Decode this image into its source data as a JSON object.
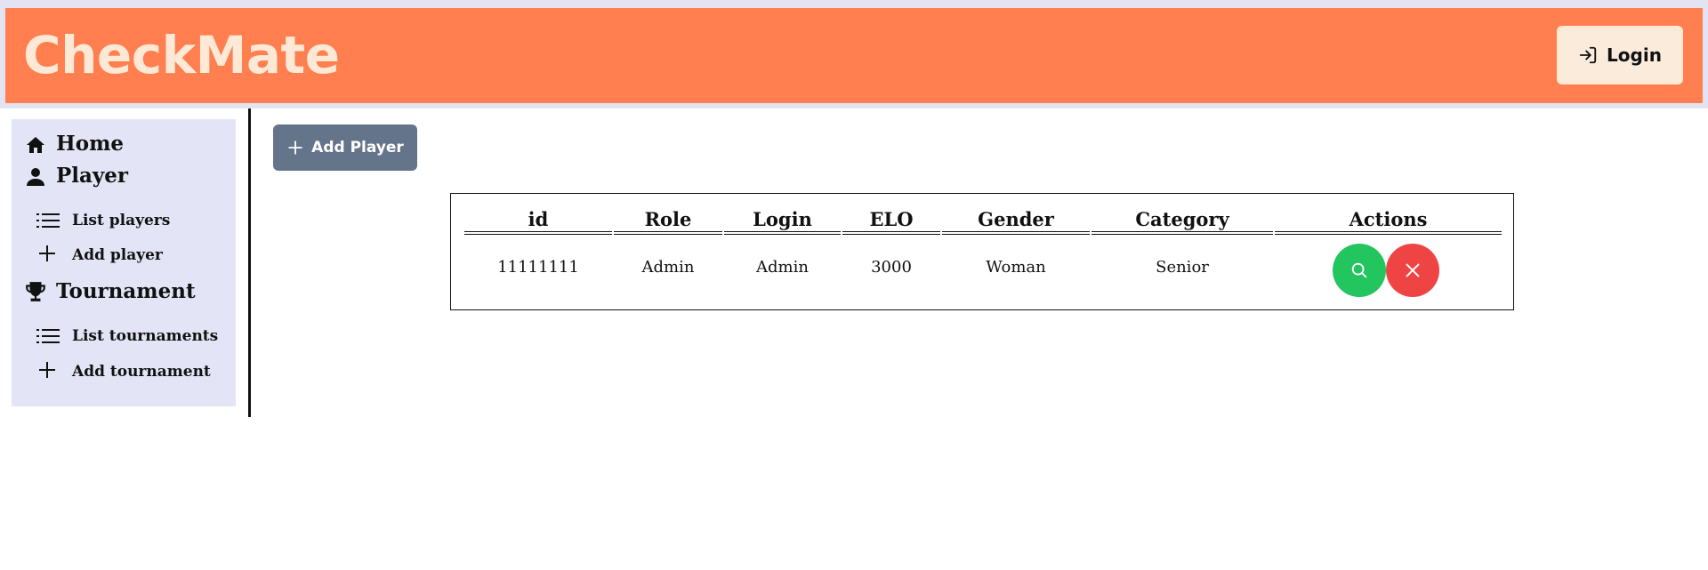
{
  "header": {
    "brand": "CheckMate",
    "login_label": "Login",
    "colors": {
      "bar": "#ff7f50",
      "brand_text": "#fde9d5",
      "login_bg": "#faebdb"
    }
  },
  "sidebar": {
    "home": "Home",
    "player": "Player",
    "list_players": "List players",
    "add_player": "Add player",
    "tournament": "Tournament",
    "list_tournaments": "List tournaments",
    "add_tournament": "Add tournament"
  },
  "main": {
    "add_player_button": "Add Player",
    "table": {
      "headers": [
        "id",
        "Role",
        "Login",
        "ELO",
        "Gender",
        "Category",
        "Actions"
      ],
      "rows": [
        [
          "11111111",
          "Admin",
          "Admin",
          "3000",
          "Woman",
          "Senior"
        ]
      ]
    }
  },
  "icons": {
    "login": "login-arrow-icon",
    "home": "home-icon",
    "player": "user-icon",
    "list": "list-icon",
    "plus": "plus-icon",
    "tournament": "trophy-icon",
    "view": "search-icon",
    "delete": "close-icon"
  },
  "colors": {
    "sidebar_bg": "#e4e4f7",
    "add_button": "#64748b",
    "view_button": "#22c55e",
    "delete_button": "#ef4444"
  }
}
